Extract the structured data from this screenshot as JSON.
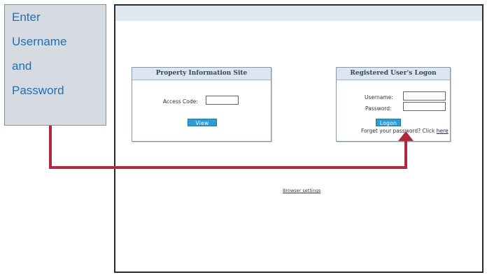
{
  "callout": {
    "lines": [
      "Enter",
      "Username",
      "and",
      "Password"
    ]
  },
  "property_panel": {
    "title": "Property Information Site",
    "access_code_label": "Access Code:",
    "access_code_value": "",
    "view_button": "View"
  },
  "logon_panel": {
    "title": "Registered User's Logon",
    "username_label": "Username:",
    "username_value": "",
    "password_label": "Password:",
    "password_value": "",
    "logon_button": "Logon",
    "forgot_text": "Forget your password? Click",
    "forgot_link": "here"
  },
  "footer": {
    "browser_settings_link": "Browser settings"
  },
  "colors": {
    "callout_text": "#1f6fb5",
    "arrow": "#c0392b",
    "button": "#2f9bd4",
    "panel_header": "#dce6f1"
  }
}
